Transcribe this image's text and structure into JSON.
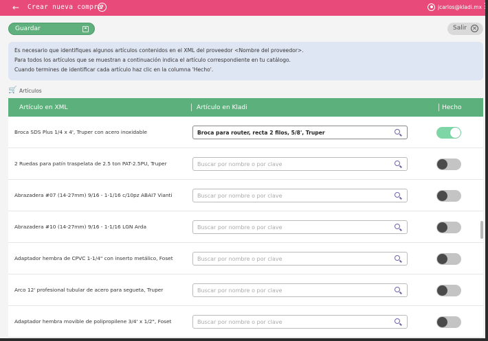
{
  "topbar": {
    "title": "Crear nueva compra",
    "user_email": "jcarlos@kladi.mx",
    "back_glyph": "←",
    "help_glyph": "?",
    "menu_glyph": "⋮",
    "accent_color": "#e84a7a"
  },
  "toolbar": {
    "save_label": "Guardar",
    "exit_label": "Salir",
    "close_glyph": "✕"
  },
  "info": {
    "line1": "Es necesario que identifiques algunos artículos contenidos en el XML del proveedor <Nombre del proveedor>.",
    "line2": "Para todos los artículos que se muestran a continuación indica el artículo correspondiente en tu catálogo.",
    "line3": "Cuando termines de identificar cada artículo haz clic en la columna 'Hecho'."
  },
  "section": {
    "label": "Artículos",
    "cart_glyph": "🛒"
  },
  "table": {
    "headers": {
      "xml": "Artículo en XML",
      "kladi": "Artículo en Kladi",
      "done": "Hecho"
    },
    "header_color": "#5cb07b",
    "placeholder": "Buscar por nombre o por clave",
    "rows": [
      {
        "name": "Broca SDS Plus 1/4 x 4', Truper con acero inoxidable",
        "match": "Broca para router, recta 2 filos, 5/8', Truper",
        "done": true
      },
      {
        "name": "2 Ruedas para patín traspelata de 2.5 ton PAT-2.5PU, Truper",
        "match": "",
        "done": false
      },
      {
        "name": "Abrazadera #07 (14-27mm) 9/16 - 1-1/16 c/10pz ABAI7 Vianti",
        "match": "",
        "done": false
      },
      {
        "name": "Abrazadera #10 (14-27mm) 9/16 - 1-1/16 LGN Arda",
        "match": "",
        "done": false
      },
      {
        "name": "Adaptador hembra de CPVC 1-1/4\" con inserto metálico, Foset",
        "match": "",
        "done": false
      },
      {
        "name": "Arco 12' profesional tubular de acero para segueta, Truper",
        "match": "",
        "done": false
      },
      {
        "name": "Adaptador hembra movible de polipropilene 3/4' x 1/2\", Foset",
        "match": "",
        "done": false
      }
    ]
  }
}
